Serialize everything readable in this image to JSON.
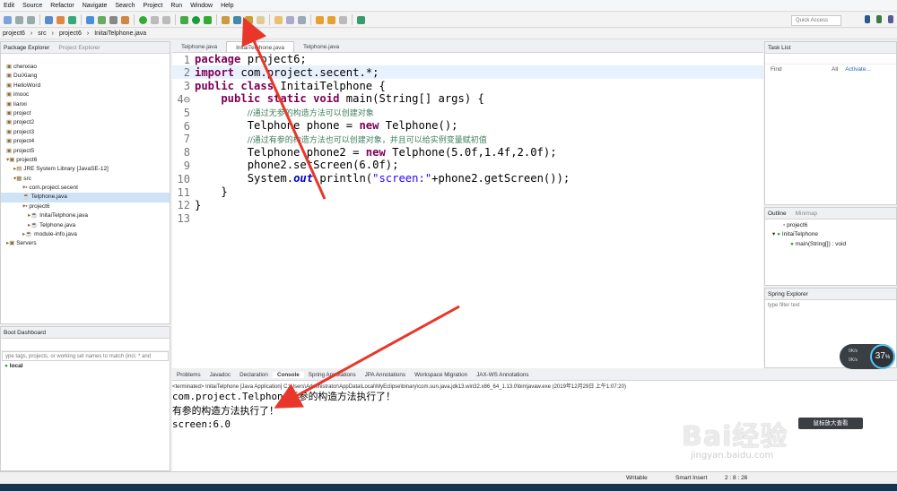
{
  "menu": [
    "Edit",
    "Source",
    "Refactor",
    "Navigate",
    "Search",
    "Project",
    "Run",
    "Window",
    "Help"
  ],
  "quick_access": "Quick Access",
  "breadcrumb": [
    "project6",
    "src",
    "project6",
    "InitaiTelphone.java"
  ],
  "package_explorer": {
    "title": "Package Explorer",
    "other_tab": "Project Explorer",
    "items": [
      "chenxiao",
      "DuiXiang",
      "HelloWord",
      "imooc",
      "lianxi",
      "project",
      "project2",
      "project3",
      "project4",
      "project5",
      "project6",
      "JRE System Library [JavaSE-12]",
      "src",
      "com.project.secent",
      "Telphone.java",
      "project6",
      "InitaiTelphone.java",
      "Telphone.java",
      "module-info.java",
      "Servers"
    ]
  },
  "boot_dashboard": {
    "title": "Boot Dashboard",
    "filter_placeholder": "ype tags, projects, or working set names to match (incl. * and",
    "local": "local"
  },
  "editor": {
    "tabs": [
      "Telphone.java",
      "InitaiTelphone.java",
      "Telphone.java"
    ],
    "line_numbers": [
      "1",
      "2",
      "3",
      "4⊖",
      "5",
      "6",
      "7",
      "8",
      "9",
      "10",
      "11",
      "12",
      "13"
    ],
    "code": [
      {
        "parts": [
          {
            "t": "package",
            "c": "kw"
          },
          {
            "t": " project6;",
            "c": ""
          }
        ]
      },
      {
        "parts": [
          {
            "t": "import",
            "c": "kw"
          },
          {
            "t": " com.project.secent.*;",
            "c": ""
          }
        ]
      },
      {
        "parts": [
          {
            "t": "public class",
            "c": "kw"
          },
          {
            "t": " InitaiTelphone {",
            "c": ""
          }
        ]
      },
      {
        "parts": [
          {
            "t": "    public static void",
            "c": "kw"
          },
          {
            "t": " main(String[] args) {",
            "c": ""
          }
        ]
      },
      {
        "parts": [
          {
            "t": "        ",
            "c": ""
          },
          {
            "t": "//通过无参的构造方法可以创建对象",
            "c": "cm"
          }
        ]
      },
      {
        "parts": [
          {
            "t": "        Telphone phone = ",
            "c": ""
          },
          {
            "t": "new",
            "c": "kw"
          },
          {
            "t": " Telphone();",
            "c": ""
          }
        ]
      },
      {
        "parts": [
          {
            "t": "        ",
            "c": ""
          },
          {
            "t": "//通过有参的构造方法也可以创建对象，并且可以给实例变量赋初值",
            "c": "cm"
          }
        ]
      },
      {
        "parts": [
          {
            "t": "        Telphone phone2 = ",
            "c": ""
          },
          {
            "t": "new",
            "c": "kw"
          },
          {
            "t": " Telphone(5.0f,1.4f,2.0f);",
            "c": ""
          }
        ]
      },
      {
        "parts": [
          {
            "t": "        phone2.setScreen(6.0f);",
            "c": ""
          }
        ]
      },
      {
        "parts": [
          {
            "t": "        System.",
            "c": ""
          },
          {
            "t": "out",
            "c": "fld"
          },
          {
            "t": ".println(",
            "c": ""
          },
          {
            "t": "\"screen:\"",
            "c": "st"
          },
          {
            "t": "+phone2.getScreen());",
            "c": ""
          }
        ]
      },
      {
        "parts": [
          {
            "t": "    }",
            "c": ""
          }
        ]
      },
      {
        "parts": [
          {
            "t": "}",
            "c": ""
          }
        ]
      },
      {
        "parts": [
          {
            "t": "",
            "c": ""
          }
        ]
      }
    ]
  },
  "task_list": {
    "title": "Task List",
    "find": "Find",
    "all": "All",
    "activate": "Activate..."
  },
  "outline": {
    "title": "Outline",
    "other_tab": "Minimap",
    "items": [
      "project6",
      "InitaiTelphone",
      "main(String[]) : void"
    ]
  },
  "spring_explorer": {
    "title": "Spring Explorer",
    "filter_placeholder": "type filter text"
  },
  "console": {
    "tabs": [
      "Problems",
      "Javadoc",
      "Declaration",
      "Console",
      "Spring Annotations",
      "JPA Annotations",
      "Workspace Migration",
      "JAX-WS Annotations"
    ],
    "terminated": "<terminated> InitaiTelphone [Java Application] C:\\Users\\Administrator\\AppData\\Local\\MyEclipse\\binary\\com.sun.java.jdk13.win32.x86_64_1.13.0\\bin\\javaw.exe (2019年12月29日 上午1:07:20)",
    "output": [
      "com.project.Telphone无参的构造方法执行了！",
      "有参的构造方法执行了！",
      "screen:6.0"
    ]
  },
  "status": {
    "mode": "Writable",
    "insert": "Smart Insert",
    "position": "2 : 8 : 26"
  },
  "badge": {
    "value": "37",
    "unit": "%",
    "up": "0K/s",
    "down": "0K/s"
  },
  "watermark": {
    "text": "Bai经验",
    "sub": "jingyan.baidu.com",
    "button": "鼠标放大查看"
  },
  "colors": {
    "arrow": "#e8372a",
    "accent": "#5bc4f5"
  }
}
